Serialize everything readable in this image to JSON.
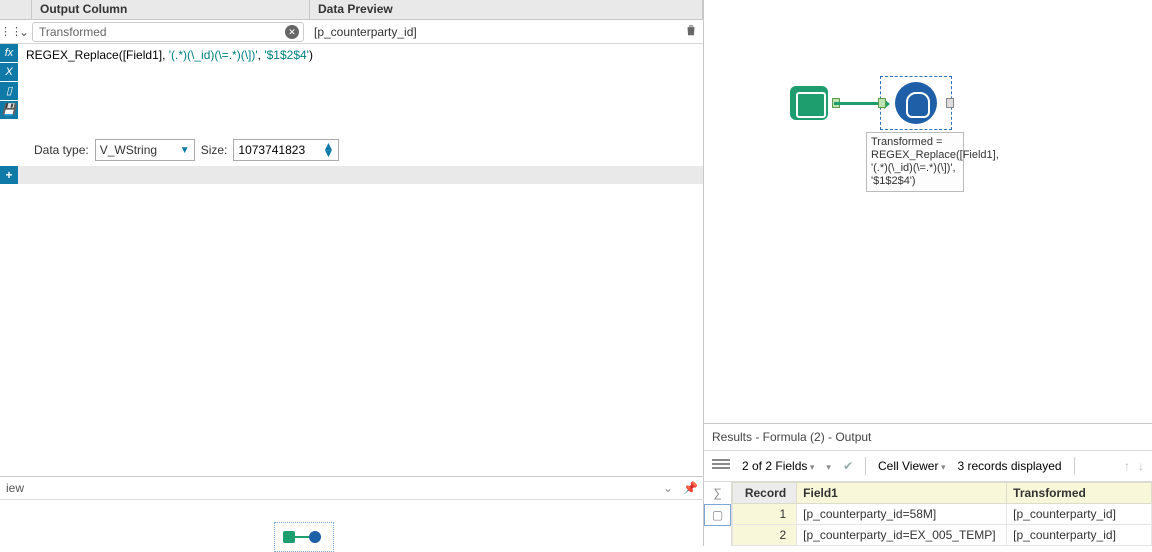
{
  "config": {
    "headers": {
      "output": "Output Column",
      "preview": "Data Preview"
    },
    "output_name": "Transformed",
    "preview_value": "[p_counterparty_id]",
    "formula_display": "REGEX_Replace([Field1], '(.*)(\\_id)(\\=.*)(\\])', '$1$2$4')",
    "formula_parts": {
      "fn": "REGEX_Replace",
      "arg1": "[Field1]",
      "lit1": "'(.*)(\\_id)(\\=.*)(\\])'",
      "lit2": "'$1$2$4'"
    },
    "datatype_label": "Data type:",
    "datatype_value": "V_WString",
    "size_label": "Size:",
    "size_value": "1073741823"
  },
  "overview": {
    "label": "iew"
  },
  "canvas": {
    "formula_caption": "Transformed = REGEX_Replace([Field1], '(.*)(\\_id)(\\=.*)(\\])', '$1$2$4')"
  },
  "results": {
    "title": "Results - Formula (2) - Output",
    "fields_summary": "2 of 2 Fields",
    "cell_viewer": "Cell Viewer",
    "records_summary": "3 records displayed",
    "columns": {
      "record": "Record",
      "field1": "Field1",
      "transformed": "Transformed"
    },
    "rows": [
      {
        "n": "1",
        "field1": "[p_counterparty_id=58M]",
        "transformed": "[p_counterparty_id]"
      },
      {
        "n": "2",
        "field1": "[p_counterparty_id=EX_005_TEMP]",
        "transformed": "[p_counterparty_id]"
      }
    ]
  }
}
